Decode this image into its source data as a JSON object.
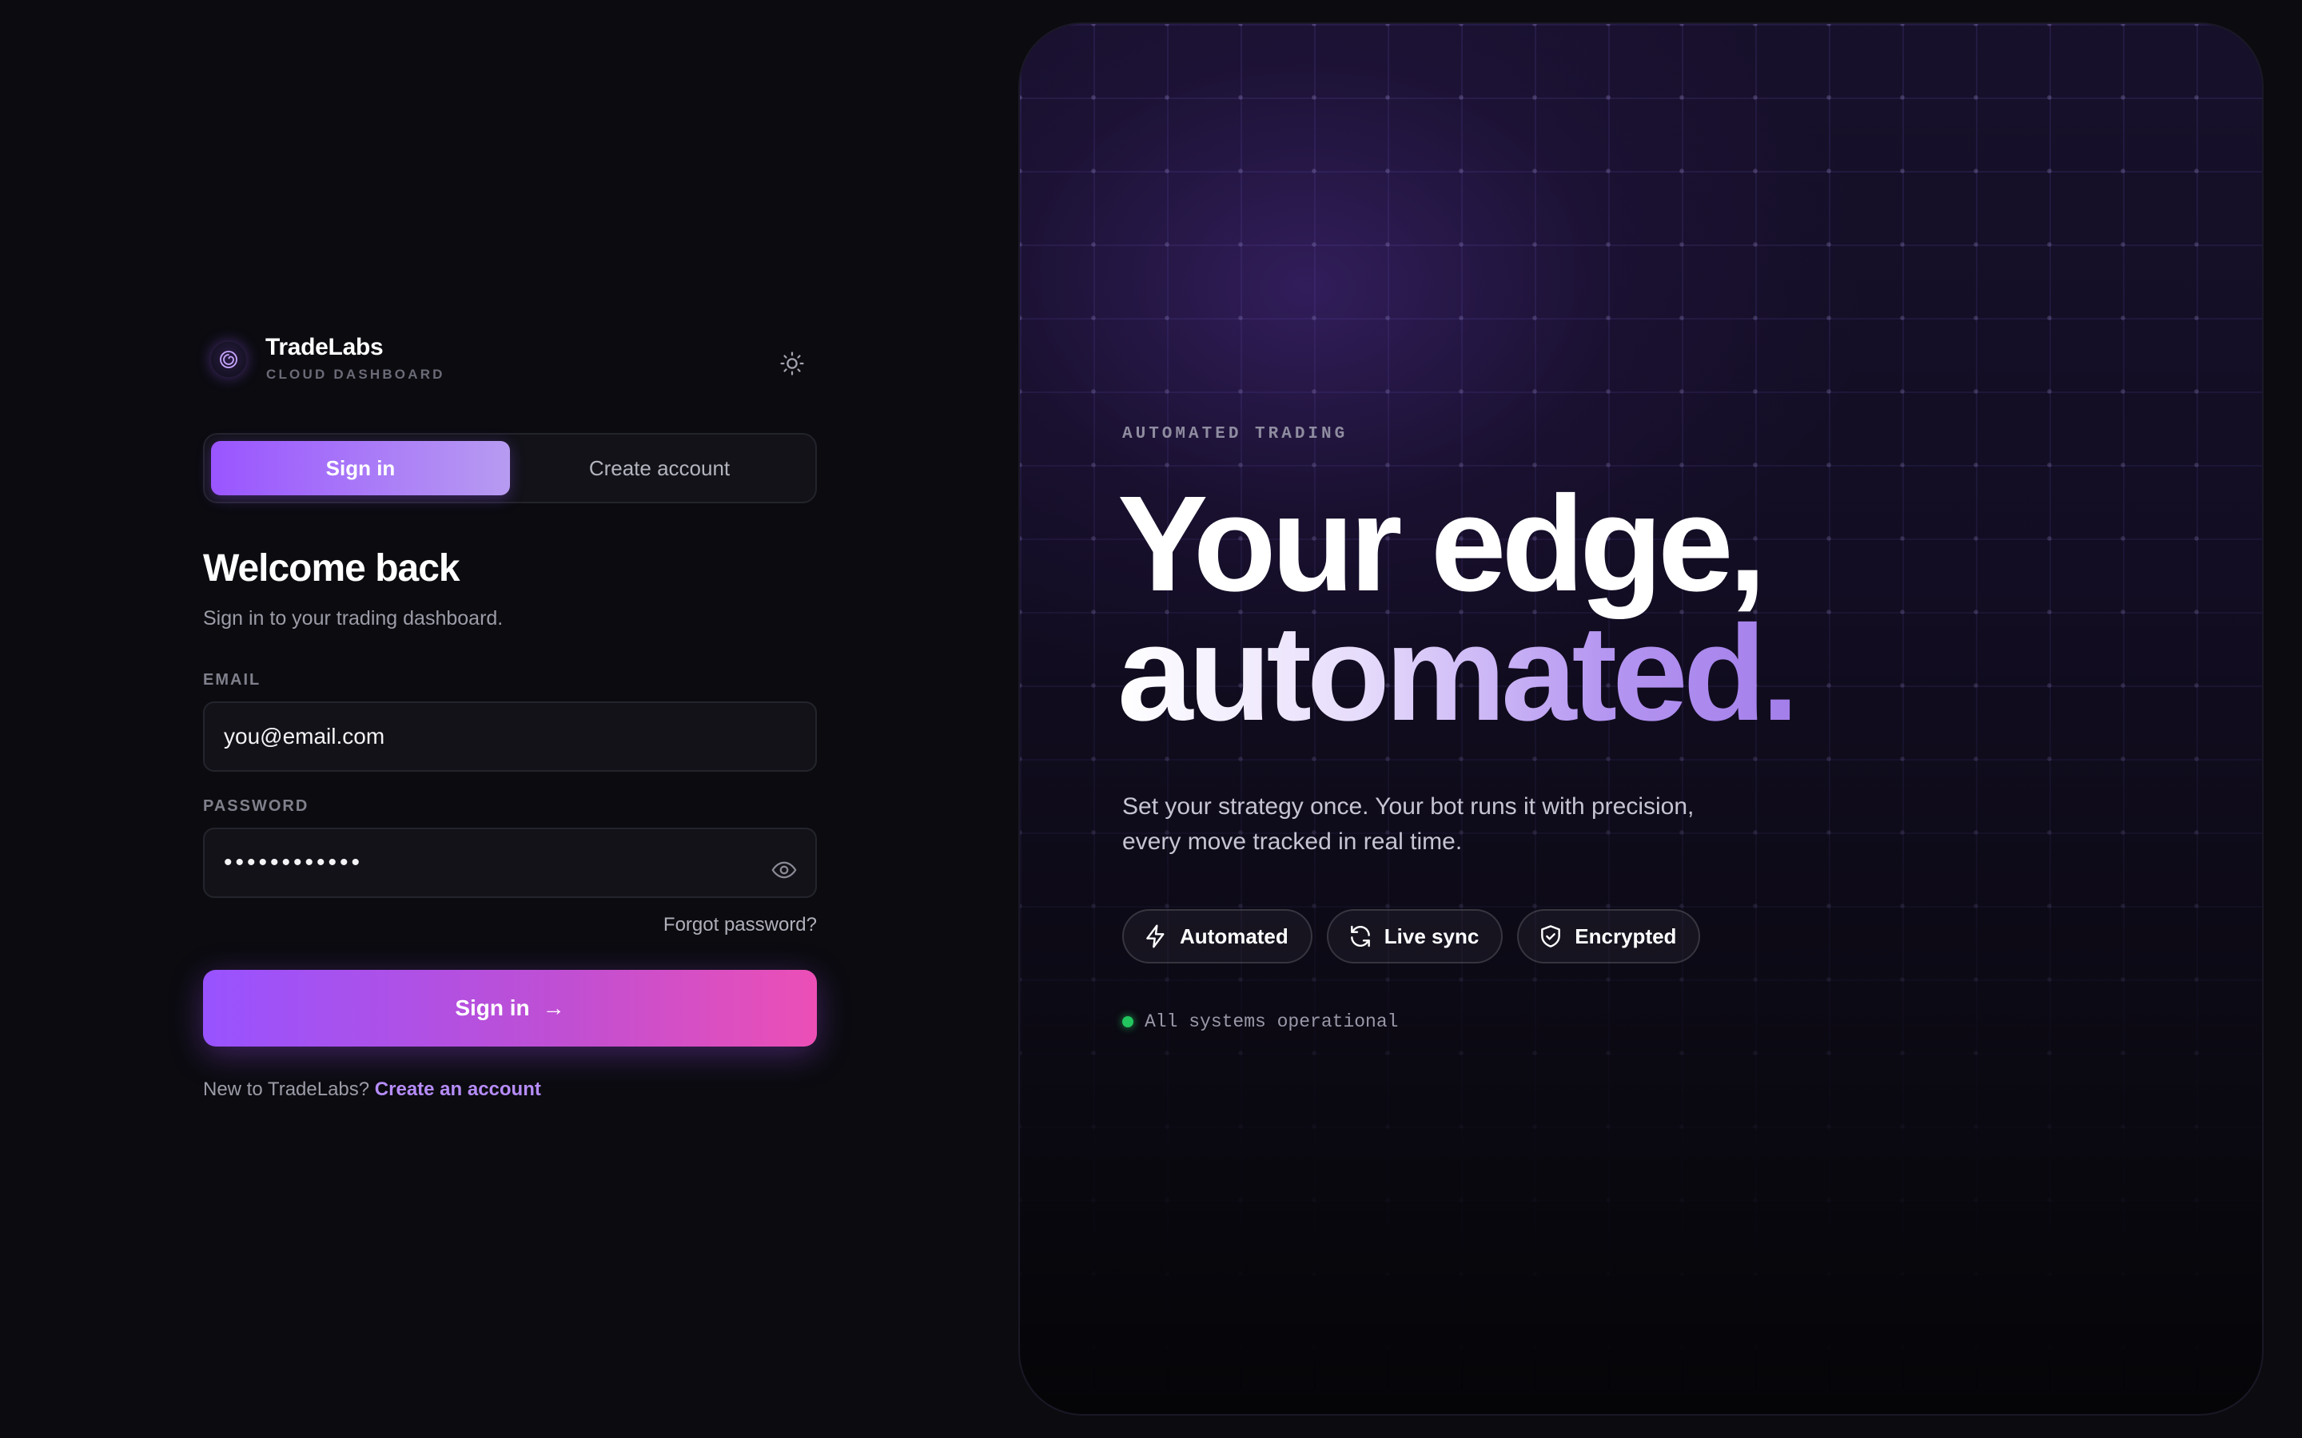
{
  "brand": {
    "name": "TradeLabs",
    "subtitle": "CLOUD DASHBOARD",
    "logo_icon": "spiral-logo-icon",
    "theme_icon": "sun-icon"
  },
  "auth_tabs": [
    {
      "label": "Sign in",
      "active": true
    },
    {
      "label": "Create account",
      "active": false
    }
  ],
  "form": {
    "title": "Welcome back",
    "subtitle": "Sign in to your trading dashboard.",
    "email": {
      "label": "EMAIL",
      "placeholder": "you@email.com",
      "value": ""
    },
    "password": {
      "label": "PASSWORD",
      "value": "passwordpass",
      "reveal_icon": "eye-icon"
    },
    "forgot_label": "Forgot password?",
    "submit_label": "Sign in",
    "submit_arrow": "→",
    "footer_text": "New to TradeLabs?",
    "footer_link": "Create an account"
  },
  "hero": {
    "kicker": "AUTOMATED TRADING",
    "headline_line1": "Your edge,",
    "headline_line2": "automated.",
    "description": "Set your strategy once. Your bot runs it with precision, every move tracked in real time.",
    "badges": [
      {
        "label": "Automated",
        "icon": "lightning-icon"
      },
      {
        "label": "Live sync",
        "icon": "refresh-icon"
      },
      {
        "label": "Encrypted",
        "icon": "shield-check-icon"
      }
    ],
    "status_text": "All systems operational",
    "status_color": "#22c55e"
  },
  "colors": {
    "background": "#0b0b10",
    "accent_purple": "#9a55ff",
    "accent_pink": "#ec4fb6",
    "link": "#b68cf8"
  }
}
